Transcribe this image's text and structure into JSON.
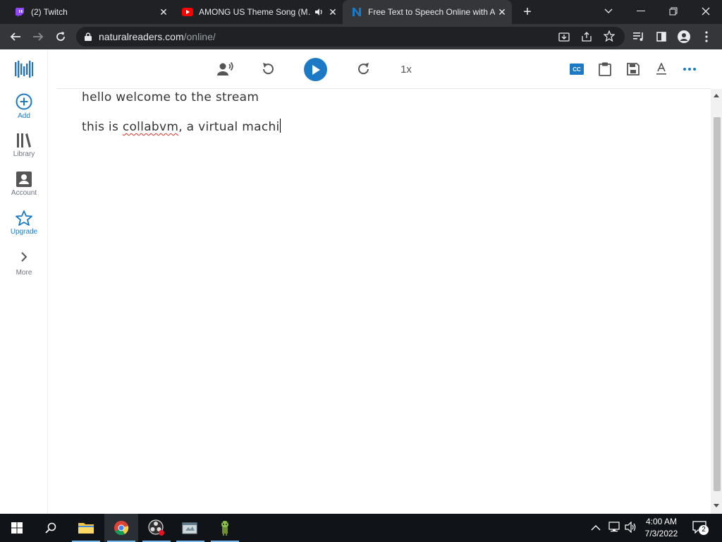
{
  "browser": {
    "tabs": [
      {
        "title": "(2) Twitch",
        "icon": "twitch-icon",
        "active": false
      },
      {
        "title": "AMONG US Theme Song (M…",
        "icon": "youtube-icon",
        "active": false
      },
      {
        "title": "Free Text to Speech Online with A…",
        "icon": "naturalreaders-icon",
        "active": true
      }
    ],
    "new_tab_label": "+",
    "url_host": "naturalreaders.com",
    "url_path": "/online/"
  },
  "sidebar": {
    "items": [
      {
        "label": "Add",
        "icon": "add-circle-icon"
      },
      {
        "label": "Library",
        "icon": "library-icon"
      },
      {
        "label": "Account",
        "icon": "account-icon"
      },
      {
        "label": "Upgrade",
        "icon": "star-icon"
      },
      {
        "label": "More",
        "icon": "chevron-right-icon"
      }
    ]
  },
  "player": {
    "speed": "1x"
  },
  "editor": {
    "line1": "hello welcome to the stream",
    "line2_before": "this is ",
    "line2_misspelled": "collabvm",
    "line2_after": ", a virtual machi"
  },
  "taskbar": {
    "time": "4:00 AM",
    "date": "7/3/2022",
    "notifications": "2"
  },
  "colors": {
    "accent": "#1b79c6",
    "chrome_dark": "#202124",
    "chrome_toolbar": "#35363a"
  }
}
